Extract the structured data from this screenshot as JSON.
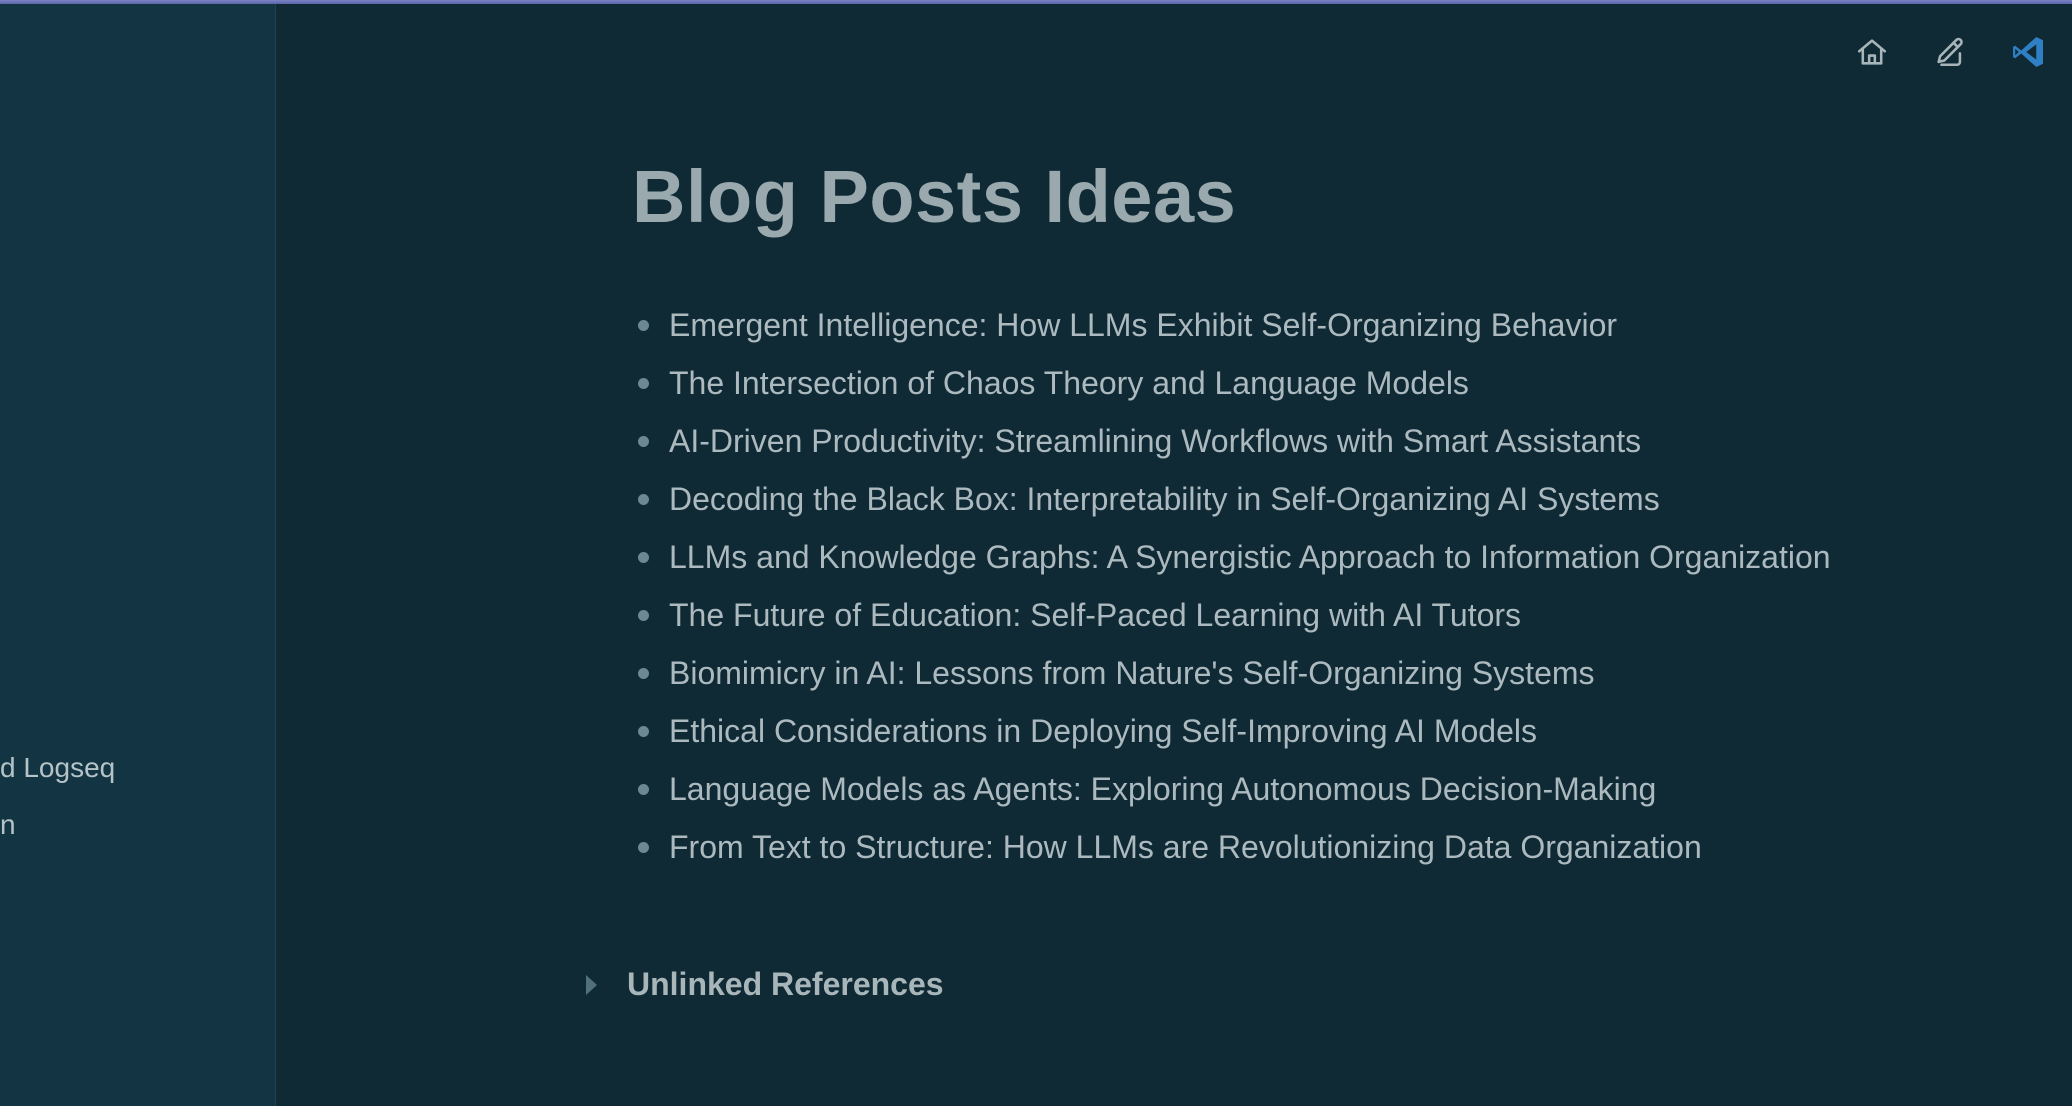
{
  "sidebar": {
    "items": [
      {
        "label": "d Logseq"
      },
      {
        "label": "n"
      }
    ]
  },
  "toolbar": {
    "icons": [
      "home-icon",
      "pencil-icon",
      "vscode-icon"
    ]
  },
  "page": {
    "title": "Blog Posts Ideas",
    "ideas": [
      "Emergent Intelligence: How LLMs Exhibit Self-Organizing Behavior",
      "The Intersection of Chaos Theory and Language Models",
      "AI-Driven Productivity: Streamlining Workflows with Smart Assistants",
      "Decoding the Black Box: Interpretability in Self-Organizing AI Systems",
      "LLMs and Knowledge Graphs: A Synergistic Approach to Information Organization",
      "The Future of Education: Self-Paced Learning with AI Tutors",
      "Biomimicry in AI: Lessons from Nature's Self-Organizing Systems",
      "Ethical Considerations in Deploying Self-Improving AI Models",
      "Language Models as Agents: Exploring Autonomous Decision-Making",
      "From Text to Structure: How LLMs are Revolutionizing Data Organization"
    ],
    "unlinked_references_label": "Unlinked References"
  },
  "colors": {
    "background": "#0f2a35",
    "sidebar": "#133543",
    "accent_vscode": "#2f7fc4"
  }
}
